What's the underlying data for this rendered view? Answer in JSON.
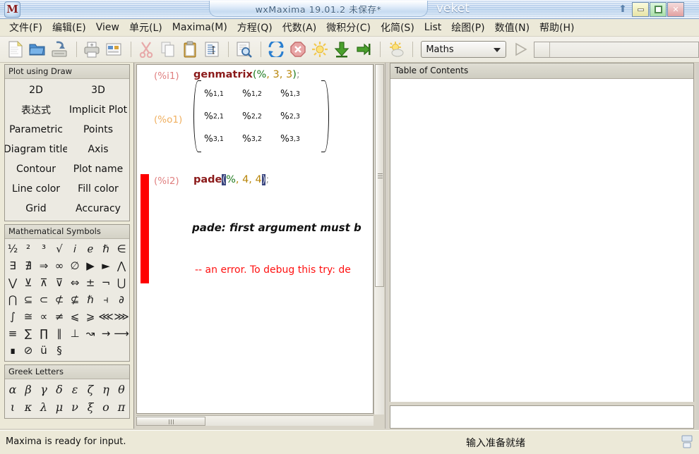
{
  "window": {
    "app_icon_letter": "M",
    "title": "wxMaxima 19.01.2 未保存*",
    "wm_name": "veket",
    "rollup_icon": "⬆",
    "minimize_label": "minimize",
    "maximize_label": "maximize",
    "close_label": "✕"
  },
  "menubar": {
    "items": [
      {
        "label": "文件(F)"
      },
      {
        "label": "编辑(E)"
      },
      {
        "label": "View"
      },
      {
        "label": "单元(L)"
      },
      {
        "label": "Maxima(M)"
      },
      {
        "label": "方程(Q)"
      },
      {
        "label": "代数(A)"
      },
      {
        "label": "微积分(C)"
      },
      {
        "label": "化简(S)"
      },
      {
        "label": "List"
      },
      {
        "label": "绘图(P)"
      },
      {
        "label": "数值(N)"
      },
      {
        "label": "帮助(H)"
      }
    ]
  },
  "toolbar": {
    "buttons": [
      {
        "name": "new-document-icon"
      },
      {
        "name": "open-folder-icon"
      },
      {
        "name": "save-icon"
      },
      {
        "name": "print-icon"
      },
      {
        "name": "preferences-icon"
      },
      {
        "name": "cut-icon"
      },
      {
        "name": "copy-icon"
      },
      {
        "name": "paste-icon"
      },
      {
        "name": "select-all-icon"
      },
      {
        "name": "find-icon"
      },
      {
        "name": "restart-maxima-icon"
      },
      {
        "name": "interrupt-icon"
      },
      {
        "name": "evaluate-all-icon"
      },
      {
        "name": "evaluate-to-cursor-icon"
      },
      {
        "name": "insert-cell-icon"
      }
    ],
    "math_mode_combo": "Maths",
    "run_button_label": "▷",
    "search_value": "",
    "search_placeholder": ""
  },
  "sidebar": {
    "draw_panel": {
      "title": "Plot using Draw",
      "buttons": [
        "2D",
        "3D",
        "表达式",
        "Implicit Plot",
        "Parametric",
        "Points",
        "Diagram title",
        "Axis",
        "Contour",
        "Plot name",
        "Line color",
        "Fill color",
        "Grid",
        "Accuracy"
      ]
    },
    "math_symbols_panel": {
      "title": "Mathematical Symbols",
      "symbols": [
        "½",
        "²",
        "³",
        "√",
        "𝑖",
        "ℯ",
        "ℏ",
        "∈",
        "∃",
        "∄",
        "⇒",
        "∞",
        "∅",
        "▶",
        "►",
        "⋀",
        "⋁",
        "⊻",
        "⊼",
        "⊽",
        "⇔",
        "±",
        "¬",
        "⋃",
        "⋂",
        "⊆",
        "⊂",
        "⊄",
        "⊈",
        "ℏ",
        "⫞",
        "∂",
        "∫",
        "≅",
        "∝",
        "≠",
        "⩽",
        "⩾",
        "⋘",
        "⋙",
        "≡",
        "∑",
        "∏",
        "∥",
        "⊥",
        "↝",
        "→",
        "⟶",
        "∎",
        "⊘",
        "ü",
        "§"
      ]
    },
    "greek_panel": {
      "title": "Greek Letters",
      "letters": [
        "α",
        "β",
        "γ",
        "δ",
        "ε",
        "ζ",
        "η",
        "θ",
        "ι",
        "κ",
        "λ",
        "μ",
        "ν",
        "ξ",
        "ο",
        "π"
      ]
    }
  },
  "worksheet": {
    "cell1": {
      "prompt": "(%i1)",
      "fn": "genmatrix",
      "open_paren": "(",
      "arg_percent": "%",
      "sep1": ", ",
      "arg2": "3",
      "sep2": ", ",
      "arg3": "3",
      "close_paren": ")",
      "terminator": ";"
    },
    "output1": {
      "prompt": "(%o1)",
      "matrix": [
        [
          "%",
          "1,1",
          "%",
          "1,2",
          "%",
          "1,3"
        ],
        [
          "%",
          "2,1",
          "%",
          "2,2",
          "%",
          "2,3"
        ],
        [
          "%",
          "3,1",
          "%",
          "3,2",
          "%",
          "3,3"
        ]
      ]
    },
    "cell2": {
      "prompt": "(%i2)",
      "fn": "pade",
      "open_paren": "(",
      "arg_percent": "%",
      "sep1": ", ",
      "arg2": "4",
      "sep2": ", ",
      "arg3": "4",
      "close_paren": ")",
      "terminator": ";"
    },
    "error": {
      "title": "pade: first argument must b",
      "detail": "-- an error. To debug this try: de",
      "marker_color": "#fe0000"
    }
  },
  "toc": {
    "title": "Table of Contents",
    "items": [],
    "search_value": ""
  },
  "statusbar": {
    "left": "Maxima is ready for input.",
    "center": "输入准备就绪"
  },
  "colors": {
    "input_prompt": "#e08080",
    "output_prompt": "#f0b060",
    "function": "#8b1a1a",
    "percent": "#1f7a1f",
    "number": "#b8860b",
    "error_red": "#ff1111",
    "paren_highlight": "#39457e",
    "titlebar_blue": "#b8d2ef",
    "panel_bg": "#ece9d8"
  }
}
